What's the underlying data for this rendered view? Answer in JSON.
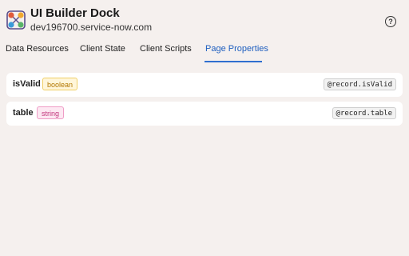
{
  "header": {
    "title": "UI Builder Dock",
    "host": "dev196700.service-now.com",
    "help_icon": "help-circle-icon",
    "logo_icon": "network-nodes-icon"
  },
  "tabs": [
    {
      "label": "Data Resources",
      "active": false
    },
    {
      "label": "Client State",
      "active": false
    },
    {
      "label": "Client Scripts",
      "active": false
    },
    {
      "label": "Page Properties",
      "active": true
    }
  ],
  "properties": [
    {
      "name": "isValid",
      "type": "boolean",
      "binding": "@record.isValid"
    },
    {
      "name": "table",
      "type": "string",
      "binding": "@record.table"
    }
  ],
  "colors": {
    "active_tab": "#1f5fbf",
    "boolean_badge": "#b27700",
    "string_badge": "#c2357b",
    "background": "#f5f0ee"
  }
}
